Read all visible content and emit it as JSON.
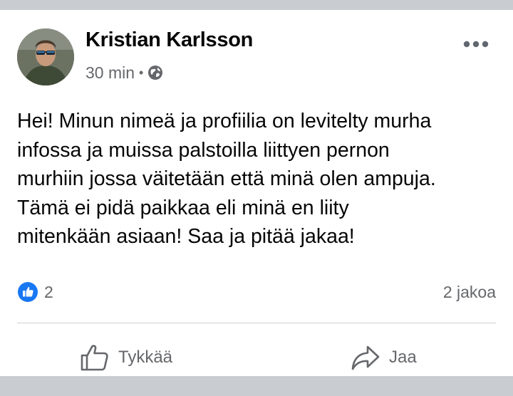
{
  "post": {
    "author": "Kristian Karlsson",
    "time": "30 min",
    "separator": "•",
    "privacy_icon": "globe-icon",
    "text": "Hei! Minun nimeä ja profiilia on levitelty murha\ninfossa ja muissa palstoilla liittyen pernon\nmurhiin jossa väitetään että minä olen ampuja.\nTämä ei pidä paikkaa eli minä en liity\nmitenkään asiaan! Saa ja pitää jakaa!"
  },
  "stats": {
    "reaction_icon": "like-reaction-icon",
    "reaction_count": "2",
    "shares": "2 jakoa"
  },
  "actions": {
    "like_label": "Tykkää",
    "share_label": "Jaa"
  },
  "colors": {
    "background_band": "#c9ccd1",
    "card": "#ffffff",
    "text": "#050505",
    "secondary_text": "#65676b",
    "like_blue": "#1877f2",
    "divider": "#ced0d4"
  }
}
